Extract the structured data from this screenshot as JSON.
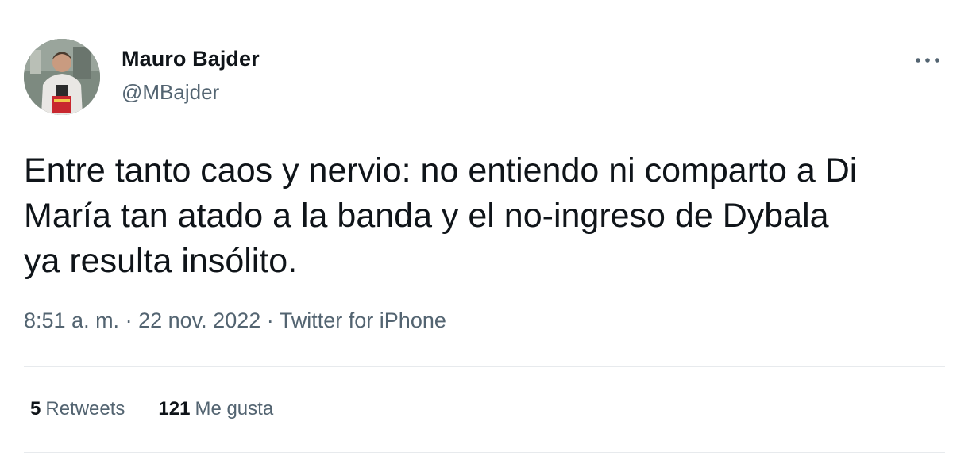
{
  "author": {
    "name": "Mauro Bajder",
    "handle": "@MBajder",
    "avatar_icon": "profile-photo"
  },
  "tweet": {
    "lines": [
      "Entre tanto caos y nervio: no entiendo ni comparto a Di",
      "María tan atado a la banda y el no-ingreso de Dybala",
      "ya resulta insólito."
    ]
  },
  "meta": {
    "time": "8:51 a. m.",
    "date": "22 nov. 2022",
    "source": "Twitter for iPhone",
    "separator": "·"
  },
  "stats": {
    "retweets_count": "5",
    "retweets_label": "Retweets",
    "likes_count": "121",
    "likes_label": "Me gusta"
  },
  "icons": {
    "more": "more-horizontal-icon"
  },
  "colors": {
    "text_primary": "#0f1419",
    "text_secondary": "#536471",
    "divider": "#e7eaed"
  }
}
